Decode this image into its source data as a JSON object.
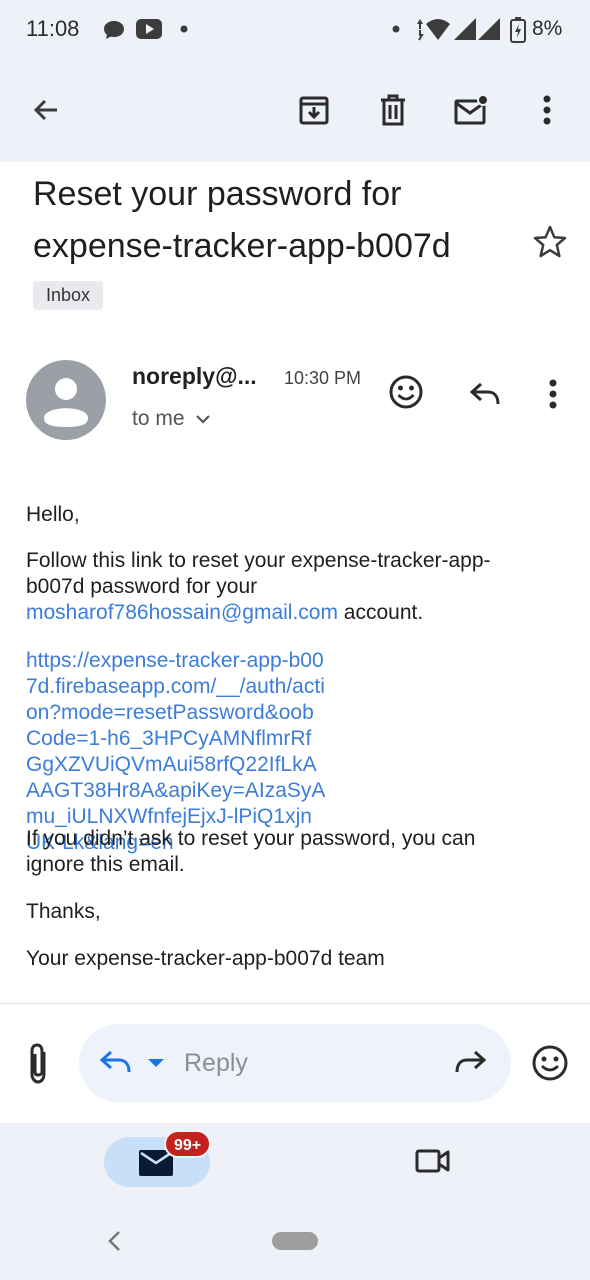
{
  "status_bar": {
    "time": "11:08",
    "battery": "8%",
    "icons": [
      "chat-bubble-icon",
      "youtube-icon",
      "dot-icon",
      "wifi-icon",
      "signal-icon",
      "battery-charging-icon"
    ]
  },
  "toolbar": {
    "back_icon": "arrow-left-icon",
    "archive_icon": "archive-icon",
    "delete_icon": "trash-icon",
    "mark_unread_icon": "mail-unread-icon",
    "more_icon": "more-vert-icon"
  },
  "email": {
    "subject": "Reset your password for expense-tracker-app-b007d",
    "label": "Inbox",
    "sender": "noreply@...",
    "time": "10:30 PM",
    "recipient": "to me",
    "body": {
      "greeting": "Hello,",
      "line1_text": "Follow this link to reset your expense-tracker-app-b007d password for your",
      "email_link": "mosharof786hossain@gmail.com",
      "line1_end": " account.",
      "reset_link": "https://expense-tracker-app-b007d.firebaseapp.com/__/auth/action?mode=resetPassword&oobCode=1-h6_3HPCyAMNflmrRfGgXZVUiQVmAui58rfQ22IfLkAAAGT38Hr8A&apiKey=AIzaSyAmu_iULNXWfnfejEjxJ-lPiQ1xjnUK-Lk&lang=en",
      "ignore_text": "If you didn’t ask to reset your password, you can ignore this email.",
      "thanks": "Thanks,",
      "signature": "Your expense-tracker-app-b007d team"
    }
  },
  "reply_bar": {
    "placeholder": "Reply"
  },
  "bottom_nav": {
    "mail_badge": "99+"
  },
  "colors": {
    "accent": "#1a73e8",
    "link": "#3d7dd8",
    "badge": "#c5221f",
    "surface": "#eef1f7"
  }
}
